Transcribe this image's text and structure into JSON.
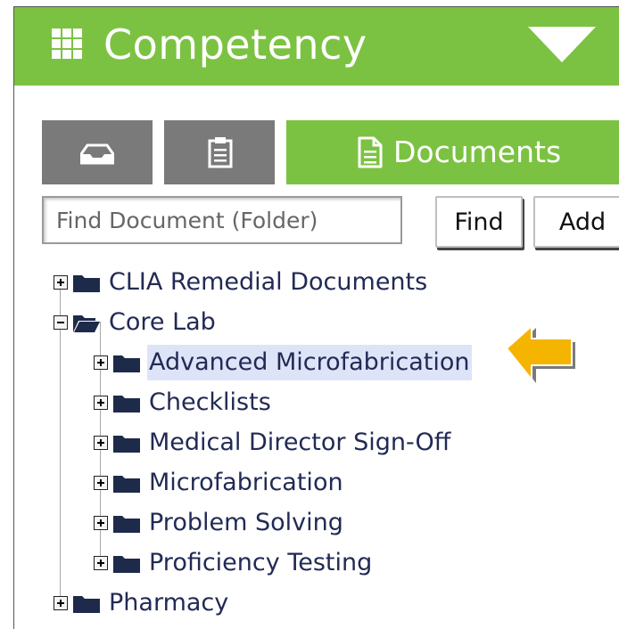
{
  "header": {
    "title": "Competency",
    "background_color": "#7cc242",
    "icon": "grid-icon",
    "menu_icon": "caret-down-icon"
  },
  "tabs": [
    {
      "name": "inbox",
      "icon": "inbox-tray-icon",
      "label": "",
      "active": false
    },
    {
      "name": "clipboard",
      "icon": "clipboard-icon",
      "label": "",
      "active": false
    },
    {
      "name": "documents",
      "icon": "document-icon",
      "label": "Documents",
      "active": true
    }
  ],
  "search": {
    "placeholder": "Find Document (Folder)",
    "value": "",
    "find_label": "Find",
    "add_label": "Add"
  },
  "tree": {
    "items": [
      {
        "label": "CLIA Remedial Documents",
        "level": 0,
        "expanded": false,
        "selected": false
      },
      {
        "label": "Core Lab",
        "level": 0,
        "expanded": true,
        "selected": false
      },
      {
        "label": "Advanced Microfabrication",
        "level": 1,
        "expanded": false,
        "selected": true
      },
      {
        "label": "Checklists",
        "level": 1,
        "expanded": false,
        "selected": false
      },
      {
        "label": "Medical Director Sign-Off",
        "level": 1,
        "expanded": false,
        "selected": false
      },
      {
        "label": "Microfabrication",
        "level": 1,
        "expanded": false,
        "selected": false
      },
      {
        "label": "Problem Solving",
        "level": 1,
        "expanded": false,
        "selected": false
      },
      {
        "label": "Proficiency Testing",
        "level": 1,
        "expanded": false,
        "selected": false
      },
      {
        "label": "Pharmacy",
        "level": 0,
        "expanded": false,
        "selected": false
      }
    ]
  },
  "colors": {
    "accent": "#7cc242",
    "tab_inactive": "#7a7a7a",
    "folder": "#1e2a4a",
    "tree_text": "#222a55",
    "selection": "#dde4f8",
    "callout_arrow": "#f5b400"
  },
  "callout": {
    "icon": "left-arrow-pointer-icon",
    "points_to": "Advanced Microfabrication"
  }
}
